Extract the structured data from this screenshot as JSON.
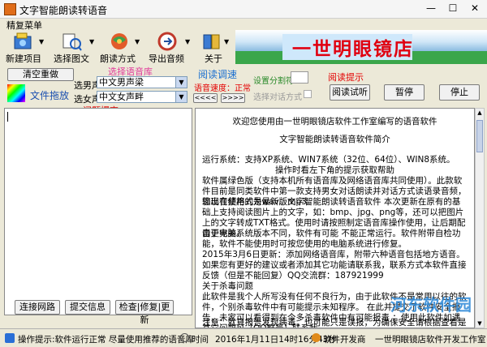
{
  "window": {
    "title": "文字智能朗读转语音",
    "minimize": "—",
    "maximize": "☐",
    "close": "✕"
  },
  "menu": {
    "items": [
      "精复菜单"
    ]
  },
  "toolbar": {
    "buttons": [
      {
        "label": "新建项目",
        "icon": "new-project-icon"
      },
      {
        "label": "选择图文",
        "icon": "select-image-text-icon"
      },
      {
        "label": "朗读方式",
        "icon": "reading-mode-icon"
      },
      {
        "label": "导出音频",
        "icon": "export-audio-icon"
      },
      {
        "label": "关于",
        "icon": "about-icon"
      }
    ]
  },
  "banner": {
    "text": "一世明眼镜店"
  },
  "controls": {
    "clear_button": "清空重做",
    "file_drag_label": "文件拖放",
    "voice_section_title": "选择语音库",
    "male_voice_label": "选男声",
    "male_voice_value": "中文男声梁",
    "female_voice_label": "选女声",
    "female_voice_value": "中文女声畔",
    "speed_title": "阅读调速",
    "speed_label": "语音速度：正常",
    "slower_button": "<<<<",
    "faster_button": ">>>>",
    "split_label": "设置分割符",
    "dialog_label": "选择对话方式",
    "hint_title": "阅读提示",
    "audition_button": "阅读试听",
    "pause_button": "暂停",
    "stop_button": "停止"
  },
  "left_panel": {
    "title": "问题提交",
    "connect_button": "连接网路",
    "submit_button": "提交信息",
    "update_button": "检查|修复|更新"
  },
  "content": {
    "line1": "欢迎您使用由一世明眼镜店软件工作室编写的语音软件",
    "line2": "文字智能朗读转语音软件简介",
    "line3": "运行系统：支持XP系统、WIN7系统（32位、64位）、WIN8系统。",
    "line4": "操作时看左下角的提示获取帮助",
    "line5": "软件属绿色版（支持本机所有语音库及网络语音库共同使用）。此款软件目前是同类软件中第一款支持男女对话朗读并对话方式读语录音频，输出音频格式为wav、mp3。",
    "line6": "您现在使用的是最新版文字智能朗读转语音软件  本次更新在原有的基础上支持阅读图片上的文字，如：bmp、jpg、png等，还可以把图片上的文字转成TXT格式。使用时请按照制定语音库操作使用，让后期配音更完美。",
    "line7": "由于电脑系统版本不同，软件有可能  不能正常运行。软件附带自检功能，软件不能使用时可按您使用的电脑系统进行修复。",
    "line8": "2015年3月6日更新：添加网络语音库，附带六种语音包括地方语音。",
    "line9": "如果您有更好的建议或者添加其它功能请联系我，联系方式本软件直接反馈（但是不能回复）QQ交流群：187921999",
    "line10": "关于杀毒问题",
    "line11": "此软件是我个人所写没有任何不良行为，由于此软件不是常用以往的软件，个别杀毒软件中有可能提示未知程序。  在此并提交了软件安全报告，未家可以看得到在今多杀毒软件中有可能报毒 ；使用此软件如遇其它问题可（QQ群号）联系我。",
    "line12": "注意：就算报告发现病毒，也可能只是误报，为确保安全请根据查看是否自行判断"
  },
  "status": {
    "op_hint": "操作提示:软件运行正常  尽量使用推荐的语音库",
    "time_label": "时间",
    "time_value": "2016年1月11日14时16分43秒",
    "developer_label": "软件开发商",
    "developer_value": "一世明眼镜店软件开发工作室"
  },
  "watermark": "河东软件园"
}
